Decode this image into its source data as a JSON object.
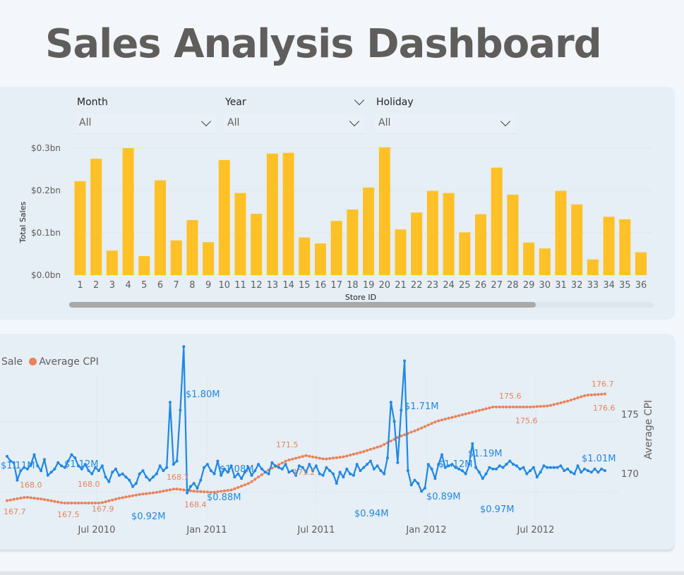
{
  "page": {
    "title": "Sales Analysis Dashboard"
  },
  "slicers": [
    {
      "label": "Month",
      "value": "All"
    },
    {
      "label": "Year",
      "value": "All"
    },
    {
      "label": "Holiday",
      "value": "All"
    }
  ],
  "colors": {
    "bar": "#ffc125",
    "sales_line": "#1e88e5",
    "cpi_line": "#e8835a",
    "title": "#605e5c",
    "card": "#e6eef6"
  },
  "chart_data": [
    {
      "type": "bar",
      "xlabel": "Store ID",
      "ylabel": "Total Sales",
      "ylim": [
        0,
        0.3
      ],
      "yticks": [
        "$0.0bn",
        "$0.1bn",
        "$0.2bn",
        "$0.3bn"
      ],
      "grid": true,
      "categories": [
        "1",
        "2",
        "3",
        "4",
        "5",
        "6",
        "7",
        "8",
        "9",
        "10",
        "11",
        "12",
        "13",
        "14",
        "15",
        "16",
        "17",
        "18",
        "19",
        "20",
        "21",
        "22",
        "23",
        "24",
        "25",
        "26",
        "27",
        "28",
        "29",
        "30",
        "31",
        "32",
        "33",
        "34",
        "35",
        "36"
      ],
      "values": [
        0.222,
        0.275,
        0.058,
        0.3,
        0.045,
        0.224,
        0.082,
        0.13,
        0.078,
        0.272,
        0.194,
        0.145,
        0.287,
        0.289,
        0.089,
        0.075,
        0.128,
        0.155,
        0.207,
        0.302,
        0.108,
        0.148,
        0.199,
        0.194,
        0.101,
        0.144,
        0.254,
        0.19,
        0.077,
        0.063,
        0.199,
        0.167,
        0.037,
        0.138,
        0.132,
        0.054
      ]
    },
    {
      "type": "line",
      "legend": [
        "Sale",
        "Average CPI"
      ],
      "y2label": "Average CPI",
      "y2ticks": [
        "170",
        "175"
      ],
      "xticks": [
        "Jul 2010",
        "Jan 2011",
        "Jul 2011",
        "Jan 2012",
        "Jul 2012"
      ],
      "x_range": [
        "2010-02-05",
        "2012-10-26"
      ],
      "sales_range_M": [
        0.7,
        1.9
      ],
      "cpi_range": [
        166.5,
        178.0
      ],
      "series": [
        {
          "name": "Sale",
          "unit": "$M",
          "values": [
            1.11,
            1.08,
            1.07,
            0.96,
            1.02,
            1.04,
            1.03,
            1.06,
            1.12,
            1.05,
            1.02,
            1.09,
            0.99,
            1.01,
            1.03,
            1.07,
            1.05,
            1.04,
            1.08,
            1.12,
            1.1,
            1.05,
            1.03,
            1.06,
            1.02,
            1.0,
            1.04,
            1.02,
            1.05,
            0.98,
            0.95,
            1.01,
            1.03,
            0.99,
            1.0,
            0.98,
            0.96,
            0.92,
            0.94,
            1.0,
            1.02,
            0.98,
            0.96,
            0.98,
            1.0,
            1.05,
            1.02,
            1.04,
            1.45,
            1.06,
            1.08,
            1.4,
            1.8,
            0.88,
            0.92,
            0.94,
            0.91,
            0.96,
            1.04,
            1.06,
            1.02,
            1.0,
            1.08,
            0.99,
            1.03,
            1.01,
            1.05,
            0.98,
            1.0,
            0.97,
            1.01,
            1.04,
            0.99,
            1.02,
            1.06,
            1.03,
            1.01,
            1.0,
            1.07,
            1.05,
            1.04,
            1.03,
            1.06,
            1.01,
            1.02,
            0.99,
            1.05,
            1.04,
            1.01,
            1.06,
            1.02,
            1.05,
            1.0,
            0.99,
            1.04,
            1.02,
            1.0,
            0.94,
            1.01,
            0.98,
            1.03,
            1.0,
            0.99,
            1.06,
            1.02,
            1.04,
            1.06,
            1.08,
            1.03,
            1.05,
            1.02,
            1.0,
            1.1,
            1.45,
            1.33,
            1.07,
            1.4,
            1.71,
            1.02,
            0.93,
            0.96,
            0.94,
            0.89,
            0.91,
            1.06,
            1.03,
            0.97,
            1.06,
            1.12,
            1.04,
            1.05,
            1.06,
            1.04,
            1.03,
            1.02,
            1.0,
            1.06,
            1.19,
            1.04,
            1.01,
            0.97,
            1.0,
            1.04,
            1.03,
            1.03,
            1.05,
            1.04,
            1.06,
            1.08,
            1.06,
            1.05,
            1.03,
            1.04,
            1.0,
            1.02,
            1.04,
            0.98,
            1.01,
            1.05,
            1.04,
            1.04,
            1.04,
            1.04,
            1.05,
            1.02,
            1.03,
            1.01,
            1.0,
            1.05,
            1.01,
            1.03,
            1.02,
            1.01,
            1.03,
            1.01,
            1.03,
            1.02
          ]
        },
        {
          "name": "Average CPI",
          "values_per_week_anchor": [
            167.7,
            168.0,
            167.8,
            167.5,
            167.5,
            167.5,
            167.9,
            168.2,
            168.4,
            168.7,
            168.5,
            168.4,
            168.6,
            169.2,
            170.3,
            171.1,
            171.5,
            171.2,
            171.4,
            171.8,
            172.3,
            173.1,
            173.7,
            174.4,
            174.8,
            175.2,
            175.6,
            175.6,
            175.6,
            175.7,
            176.1,
            176.6,
            176.7
          ]
        }
      ],
      "data_labels": [
        {
          "series": "Sale",
          "text": "$1.11M"
        },
        {
          "series": "Sale",
          "text": "$1.12M"
        },
        {
          "series": "Sale",
          "text": "$0.92M"
        },
        {
          "series": "Sale",
          "text": "$1.80M"
        },
        {
          "series": "Sale",
          "text": "$0.88M"
        },
        {
          "series": "Sale",
          "text": "$1.08M"
        },
        {
          "series": "Sale",
          "text": "$0.94M"
        },
        {
          "series": "Sale",
          "text": "$1.71M"
        },
        {
          "series": "Sale",
          "text": "$0.89M"
        },
        {
          "series": "Sale",
          "text": "$1.12M"
        },
        {
          "series": "Sale",
          "text": "$1.19M"
        },
        {
          "series": "Sale",
          "text": "$0.97M"
        },
        {
          "series": "Sale",
          "text": "$1.01M"
        },
        {
          "series": "Average CPI",
          "text": "167.7"
        },
        {
          "series": "Average CPI",
          "text": "168.0"
        },
        {
          "series": "Average CPI",
          "text": "167.5"
        },
        {
          "series": "Average CPI",
          "text": "168.0"
        },
        {
          "series": "Average CPI",
          "text": "167.9"
        },
        {
          "series": "Average CPI",
          "text": "168.7"
        },
        {
          "series": "Average CPI",
          "text": "168.4"
        },
        {
          "series": "Average CPI",
          "text": "171.5"
        },
        {
          "series": "Average CPI",
          "text": "171.2"
        },
        {
          "series": "Average CPI",
          "text": "175.6"
        },
        {
          "series": "Average CPI",
          "text": "175.6"
        },
        {
          "series": "Average CPI",
          "text": "176.7"
        },
        {
          "series": "Average CPI",
          "text": "176.6"
        }
      ]
    }
  ]
}
